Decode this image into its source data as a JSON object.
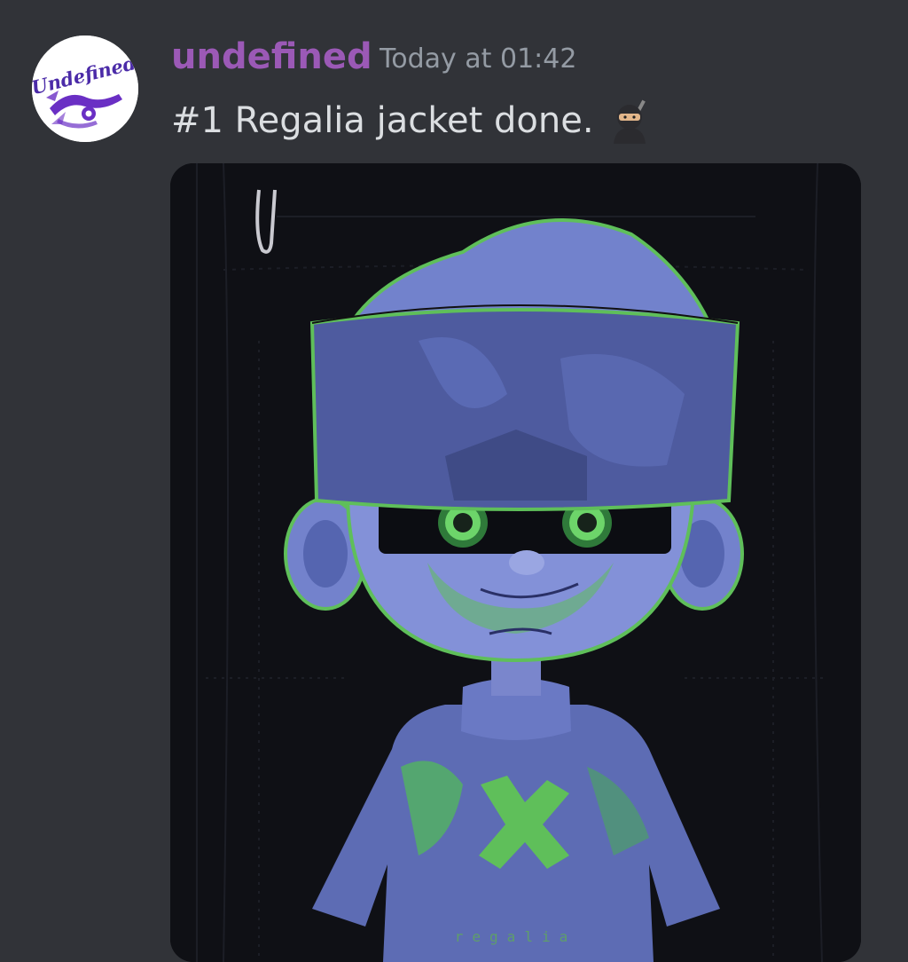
{
  "message": {
    "author": {
      "name": "undefined",
      "color": "#9b59b6",
      "avatar_text": "Undefined"
    },
    "timestamp": "Today at 01:42",
    "content": "#1 Regalia jacket done.",
    "emoji": "ninja-icon",
    "attachment": {
      "type": "image",
      "jacket_text": "regalia"
    }
  },
  "colors": {
    "background": "#313338",
    "text": "#dbdee1",
    "timestamp": "#949ba4",
    "accent_purple": "#9b59b6",
    "art_blue": "#6f7fc8",
    "art_green": "#5fbf5a"
  }
}
